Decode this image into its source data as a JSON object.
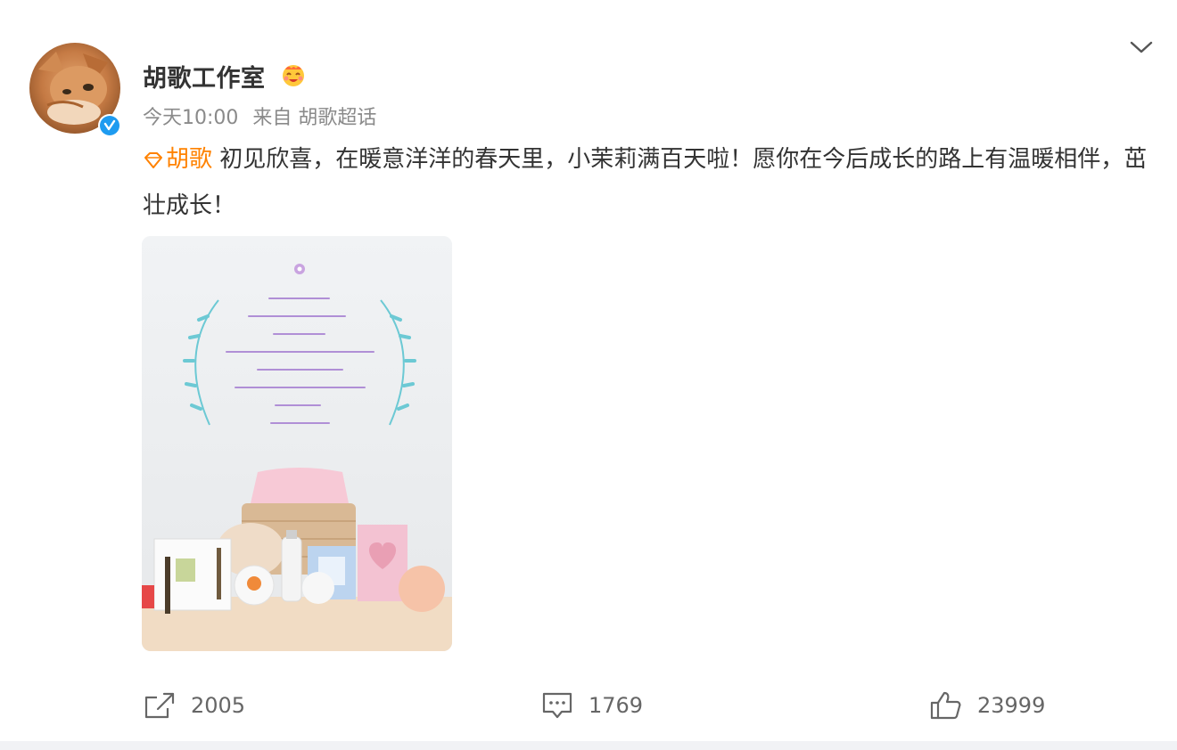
{
  "post": {
    "author": "胡歌工作室",
    "time": "今天10:00",
    "source": "来自 胡歌超话",
    "topic_tag": "胡歌",
    "text": " 初见欣喜，在暖意洋洋的春天里，小茉莉满百天啦！愿你在今后成长的路上有温暖相伴，茁壮成长！"
  },
  "actions": {
    "repost_count": "2005",
    "comment_count": "1769",
    "like_count": "23999"
  },
  "icons": {
    "collapse": "chevron-down-icon",
    "verified": "verified-badge-icon",
    "member_badge": "vip-emoji-icon",
    "topic": "diamond-topic-icon",
    "repost": "share-icon",
    "comment": "comment-icon",
    "like": "thumbs-up-icon"
  },
  "colors": {
    "accent": "#ff8200",
    "verified": "#1e9bf0",
    "text": "#333333",
    "muted": "#8a8a8a"
  }
}
